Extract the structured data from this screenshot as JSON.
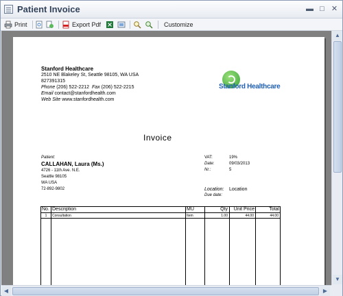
{
  "window": {
    "title": "Patient Invoice"
  },
  "toolbar": {
    "print": "Print",
    "export_pdf": "Export Pdf",
    "customize": "Customize"
  },
  "company": {
    "name": "Stanford Healthcare",
    "address": "2510 NE Blakeley St, Seattle 98105, WA USA",
    "number": "827391315",
    "phone_label": "Phone",
    "phone": "(206) 522-2212",
    "fax_label": "Fax",
    "fax": "(206) 522-2215",
    "email_label": "Email",
    "email": "contact@stanfordhealth.com",
    "web_label": "Web Site",
    "web": "www.stanfordhealth.com",
    "logo_text": "Stanford Healthcare"
  },
  "invoice": {
    "title": "Invoice",
    "patient_label": "Patient:",
    "patient_name": "CALLAHAN, Laura (Ms.)",
    "addr1": "4726 - 11th Ave. N.E.",
    "addr2": "Seattle 98105",
    "addr3": "WA USA",
    "patient_phone": "72-892-9802",
    "vat_label": "VAT:",
    "vat": "19%",
    "date_label": "Date:",
    "date": "09/03/2013",
    "no_label": "Nr.:",
    "no": "5",
    "location_label": "Location:",
    "location": "Location",
    "due_label": "Due date:"
  },
  "table": {
    "headers": {
      "no": "No.",
      "description": "Description",
      "mu": "MU",
      "qty": "Qty",
      "unit_price": "Unit Price",
      "total": "Total"
    },
    "rows": [
      {
        "no": "1",
        "description": "Consultation",
        "mu": "Item",
        "qty": "1.00",
        "unit_price": "44.00",
        "total": "44.00"
      }
    ]
  }
}
